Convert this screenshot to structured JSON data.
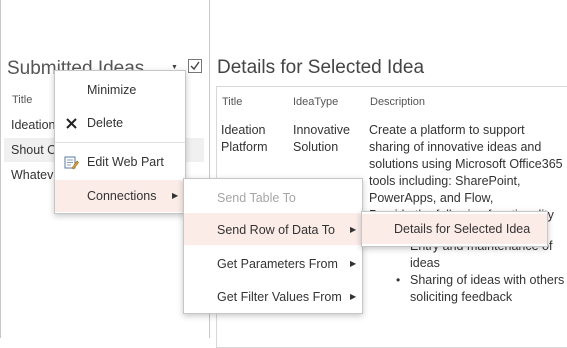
{
  "left_panel": {
    "title": "Submitted Ideas",
    "column_title": "Title",
    "rows": [
      "Ideation",
      "Shout C",
      "Whatev"
    ]
  },
  "right_panel": {
    "title": "Details for Selected Idea",
    "columns": [
      "Title",
      "IdeaType",
      "Description"
    ],
    "row": {
      "title_lines": [
        "Ideation",
        "Platform"
      ],
      "type_lines": [
        "Innovative",
        "Solution"
      ],
      "desc_lines": [
        "Create a platform to support",
        "sharing of innovative ideas and",
        "solutions using Microsoft Office365",
        "tools including: SharePoint,",
        "PowerApps, and Flow,",
        "Provide the following functionality"
      ],
      "bullets": [
        "Entry and maintenance of",
        "ideas",
        "Sharing of ideas with others",
        "soliciting feedback"
      ]
    }
  },
  "context_menu": {
    "items": [
      "Minimize",
      "Delete",
      "Edit Web Part",
      "Connections"
    ]
  },
  "connections_menu": {
    "items": [
      "Send Table To",
      "Send Row of Data To",
      "Get Parameters From",
      "Get Filter Values From"
    ]
  },
  "send_row_menu": {
    "items": [
      "Details for Selected Idea"
    ]
  },
  "colors": {
    "hover_bg": "#fbece8",
    "disabled_text": "#a6a6a6",
    "selected_row_bg": "#f0f0f0"
  }
}
